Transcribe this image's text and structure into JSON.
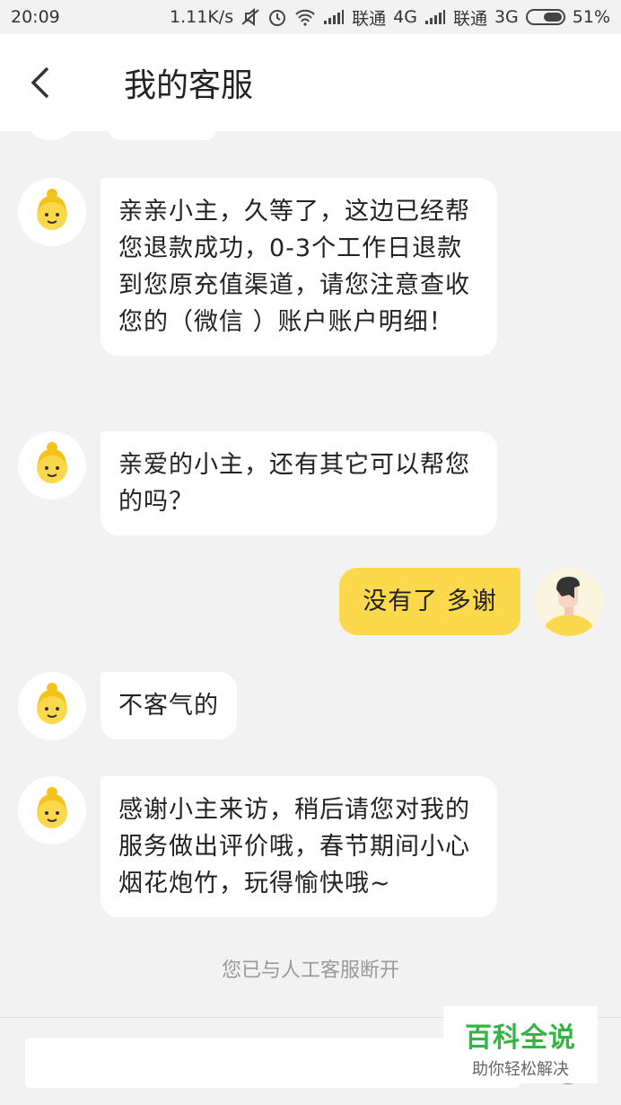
{
  "status_bar": {
    "time": "20:09",
    "net_speed": "1.11K/s",
    "carrier1": "联通",
    "net1": "4G",
    "carrier2": "联通",
    "net2": "3G",
    "battery": "51%"
  },
  "header": {
    "title": "我的客服"
  },
  "messages": [
    {
      "side": "left",
      "text": "亲亲小主，久等了，这边已经帮您退款成功，0-3个工作日退款到您原充值渠道，请您注意查收您的（微信 ）账户账户明细！"
    },
    {
      "side": "left",
      "text": "亲爱的小主，还有其它可以帮您的吗？"
    },
    {
      "side": "right",
      "text": "没有了 多谢"
    },
    {
      "side": "left",
      "text": "不客气的"
    },
    {
      "side": "left",
      "text": "感谢小主来访，稍后请您对我的服务做出评价哦，春节期间小心烟花炮竹，玩得愉快哦~"
    }
  ],
  "system_note": "您已与人工客服断开",
  "input": {
    "placeholder": ""
  },
  "watermark": {
    "title": "百科全说",
    "subtitle": "助你轻松解决"
  },
  "colors": {
    "accent": "#fcd94c",
    "background": "#f2f2f2"
  }
}
